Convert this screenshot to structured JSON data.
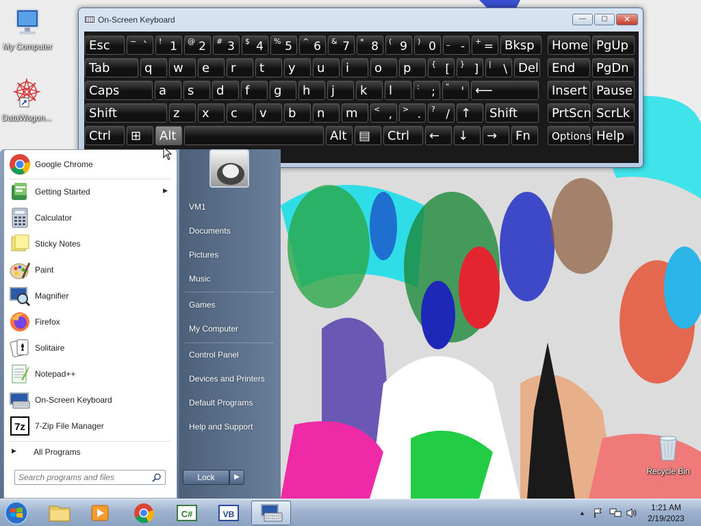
{
  "desktop": {
    "icons": [
      {
        "label": "My Computer"
      },
      {
        "label": "DataWagon..."
      },
      {
        "label": "Recycle Bin"
      }
    ]
  },
  "osk": {
    "title": "On-Screen Keyboard",
    "controls": {
      "minimize": "—",
      "maximize": "▢",
      "close": "✕"
    },
    "rows": [
      [
        {
          "main": "Esc"
        },
        {
          "s": "~",
          "b": "`"
        },
        {
          "s": "!",
          "b": "1"
        },
        {
          "s": "@",
          "b": "2"
        },
        {
          "s": "#",
          "b": "3"
        },
        {
          "s": "$",
          "b": "4"
        },
        {
          "s": "%",
          "b": "5"
        },
        {
          "s": "^",
          "b": "6"
        },
        {
          "s": "&",
          "b": "7"
        },
        {
          "s": "*",
          "b": "8"
        },
        {
          "s": "(",
          "b": "9"
        },
        {
          "s": ")",
          "b": "0"
        },
        {
          "s": "_",
          "b": "-"
        },
        {
          "s": "+",
          "b": "="
        },
        {
          "main": "Bksp"
        },
        {
          "main": "Home"
        },
        {
          "main": "PgUp"
        }
      ],
      [
        {
          "main": "Tab"
        },
        {
          "main": "q"
        },
        {
          "main": "w"
        },
        {
          "main": "e"
        },
        {
          "main": "r"
        },
        {
          "main": "t"
        },
        {
          "main": "y"
        },
        {
          "main": "u"
        },
        {
          "main": "i"
        },
        {
          "main": "o"
        },
        {
          "main": "p"
        },
        {
          "s": "{",
          "b": "["
        },
        {
          "s": "}",
          "b": "]"
        },
        {
          "s": "|",
          "b": "\\"
        },
        {
          "main": "Del"
        },
        {
          "main": "End"
        },
        {
          "main": "PgDn"
        }
      ],
      [
        {
          "main": "Caps"
        },
        {
          "main": "a"
        },
        {
          "main": "s"
        },
        {
          "main": "d"
        },
        {
          "main": "f"
        },
        {
          "main": "g"
        },
        {
          "main": "h"
        },
        {
          "main": "j"
        },
        {
          "main": "k"
        },
        {
          "main": "l"
        },
        {
          "s": ":",
          "b": ";"
        },
        {
          "s": "\"",
          "b": "'"
        },
        {
          "main": "⟵"
        },
        {
          "main": "Insert"
        },
        {
          "main": "Pause"
        }
      ],
      [
        {
          "main": "Shift"
        },
        {
          "main": "z"
        },
        {
          "main": "x"
        },
        {
          "main": "c"
        },
        {
          "main": "v"
        },
        {
          "main": "b"
        },
        {
          "main": "n"
        },
        {
          "main": "m"
        },
        {
          "s": "<",
          "b": ","
        },
        {
          "s": ">",
          "b": "."
        },
        {
          "s": "?",
          "b": "/"
        },
        {
          "main": "↑"
        },
        {
          "main": "Shift"
        },
        {
          "main": "PrtScn"
        },
        {
          "main": "ScrLk"
        }
      ],
      [
        {
          "main": "Ctrl"
        },
        {
          "main": "⊞"
        },
        {
          "main": "Alt"
        },
        {
          "main": ""
        },
        {
          "main": "Alt"
        },
        {
          "main": "▤"
        },
        {
          "main": "Ctrl"
        },
        {
          "main": "←"
        },
        {
          "main": "↓"
        },
        {
          "main": "→"
        },
        {
          "main": "Fn"
        },
        {
          "main": "Options"
        },
        {
          "main": "Help"
        }
      ]
    ]
  },
  "start_menu": {
    "programs": [
      {
        "label": "Google Chrome"
      },
      {
        "label": "Getting Started",
        "submenu": "▶"
      },
      {
        "label": "Calculator"
      },
      {
        "label": "Sticky Notes"
      },
      {
        "label": "Paint"
      },
      {
        "label": "Magnifier"
      },
      {
        "label": "Firefox"
      },
      {
        "label": "Solitaire"
      },
      {
        "label": "Notepad++"
      },
      {
        "label": "On-Screen Keyboard"
      },
      {
        "label": "7-Zip File Manager"
      }
    ],
    "all_programs": "All Programs",
    "all_programs_arrow": "▶",
    "search_placeholder": "Search programs and files",
    "right_links": [
      "VM1",
      "Documents",
      "Pictures",
      "Music",
      "Games",
      "My Computer",
      "Control Panel",
      "Devices and Printers",
      "Default Programs",
      "Help and Support"
    ],
    "lock_label": "Lock",
    "lock_arrow": "▶"
  },
  "taskbar": {
    "time": "1:21 AM",
    "date": "2/19/2023",
    "tray_up_arrow": "▲",
    "pinned": [
      "start-orb",
      "explorer",
      "media-player",
      "chrome",
      "csharp",
      "vb",
      "on-screen-keyboard"
    ],
    "icon_text": {
      "sevenzip": "7z",
      "cs": "C#",
      "vb": "VB"
    }
  }
}
